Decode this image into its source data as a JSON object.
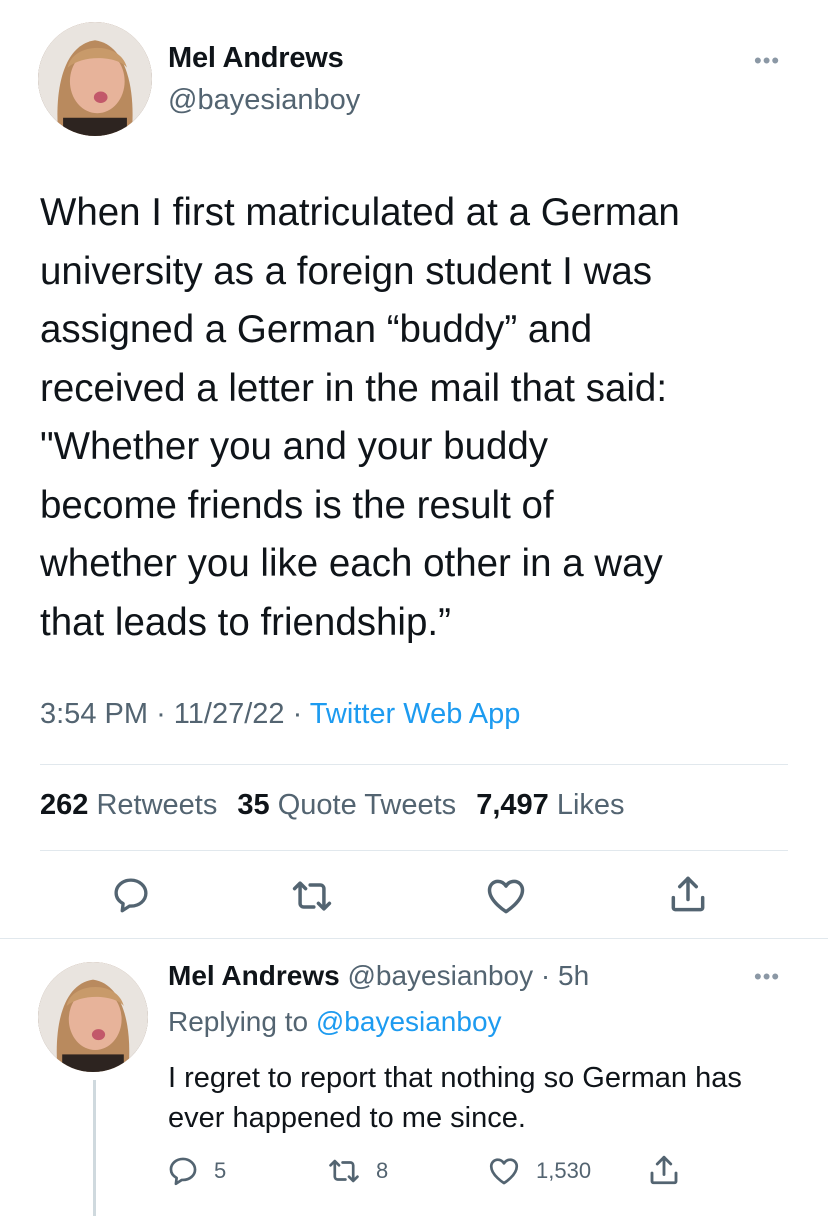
{
  "tweet": {
    "author_name": "Mel Andrews",
    "author_handle": "@bayesianboy",
    "text": "When I first matriculated at a German\nuniversity as a foreign student I was\nassigned a German “buddy” and\nreceived a letter in the mail that said:\n\"Whether you and your buddy\nbecome friends is the result of\nwhether you like each other in a way\nthat leads to friendship.”",
    "time": "3:54 PM",
    "date": "11/27/22",
    "source": "Twitter Web App",
    "stats": {
      "retweets_count": "262",
      "retweets_label": "Retweets",
      "quotes_count": "35",
      "quotes_label": "Quote Tweets",
      "likes_count": "7,497",
      "likes_label": "Likes"
    }
  },
  "reply": {
    "author_name": "Mel Andrews",
    "author_handle": "@bayesianboy",
    "age": "5h",
    "replying_prefix": "Replying to",
    "replying_to": "@bayesianboy",
    "text": "I regret to report that nothing so German has ever happened to me since.",
    "reply_count": "5",
    "retweet_count": "8",
    "like_count": "1,530"
  },
  "icons": {
    "more": "more-icon",
    "reply": "reply-icon",
    "retweet": "retweet-icon",
    "like": "heart-icon",
    "share": "share-icon"
  },
  "colors": {
    "text": "#0f1419",
    "secondary": "#536471",
    "link": "#1d9bf0",
    "divider": "#e1e8ed"
  }
}
